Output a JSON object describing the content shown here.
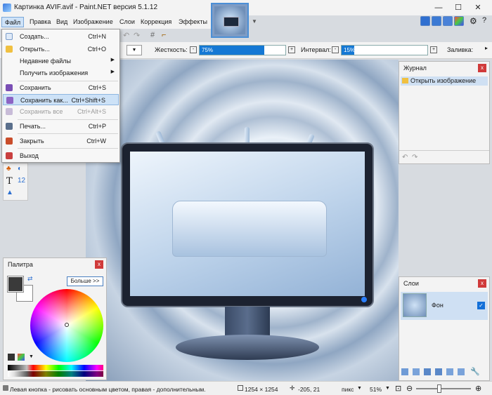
{
  "window": {
    "title": "Картинка AVIF.avif - Paint.NET версия 5.1.12"
  },
  "menubar": {
    "items": [
      "Файл",
      "Правка",
      "Вид",
      "Изображение",
      "Слои",
      "Коррекция",
      "Эффекты"
    ]
  },
  "file_menu": {
    "items": [
      {
        "label": "Создать...",
        "shortcut": "Ctrl+N",
        "enabled": true
      },
      {
        "label": "Открыть...",
        "shortcut": "Ctrl+O",
        "enabled": true
      },
      {
        "label": "Недавние файлы",
        "shortcut": "",
        "submenu": true,
        "enabled": true
      },
      {
        "label": "Получить изображения",
        "shortcut": "",
        "submenu": true,
        "enabled": true
      },
      {
        "label": "Сохранить",
        "shortcut": "Ctrl+S",
        "enabled": true
      },
      {
        "label": "Сохранить как...",
        "shortcut": "Ctrl+Shift+S",
        "enabled": true,
        "highlighted": true
      },
      {
        "label": "Сохранить все",
        "shortcut": "Ctrl+Alt+S",
        "enabled": false
      },
      {
        "label": "Печать...",
        "shortcut": "Ctrl+P",
        "enabled": true
      },
      {
        "label": "Закрыть",
        "shortcut": "Ctrl+W",
        "enabled": true
      },
      {
        "label": "Выход",
        "shortcut": "",
        "enabled": true
      }
    ]
  },
  "toolbar": {
    "hardness_label": "Жесткость:",
    "hardness_value": "75%",
    "hardness_level": 0.75,
    "interval_label": "Интервал:",
    "interval_value": "15%",
    "interval_level": 0.15,
    "fill_label": "Заливка:"
  },
  "history_panel": {
    "title": "Журнал",
    "items": [
      "Открыть изображение"
    ]
  },
  "layers_panel": {
    "title": "Слои",
    "layer_name": "Фон"
  },
  "palette_panel": {
    "title": "Палитра",
    "more_label": "Больше >>"
  },
  "statusbar": {
    "hint": "Левая кнопка - рисовать основным цветом, правая - дополнительным.",
    "image_size": "1254 × 1254",
    "cursor_pos": "-205, 21",
    "units": "пикс",
    "zoom": "51%"
  },
  "colors": {
    "accent": "#1478d4",
    "primary": "#3a3a3a",
    "secondary": "#ffffff"
  }
}
